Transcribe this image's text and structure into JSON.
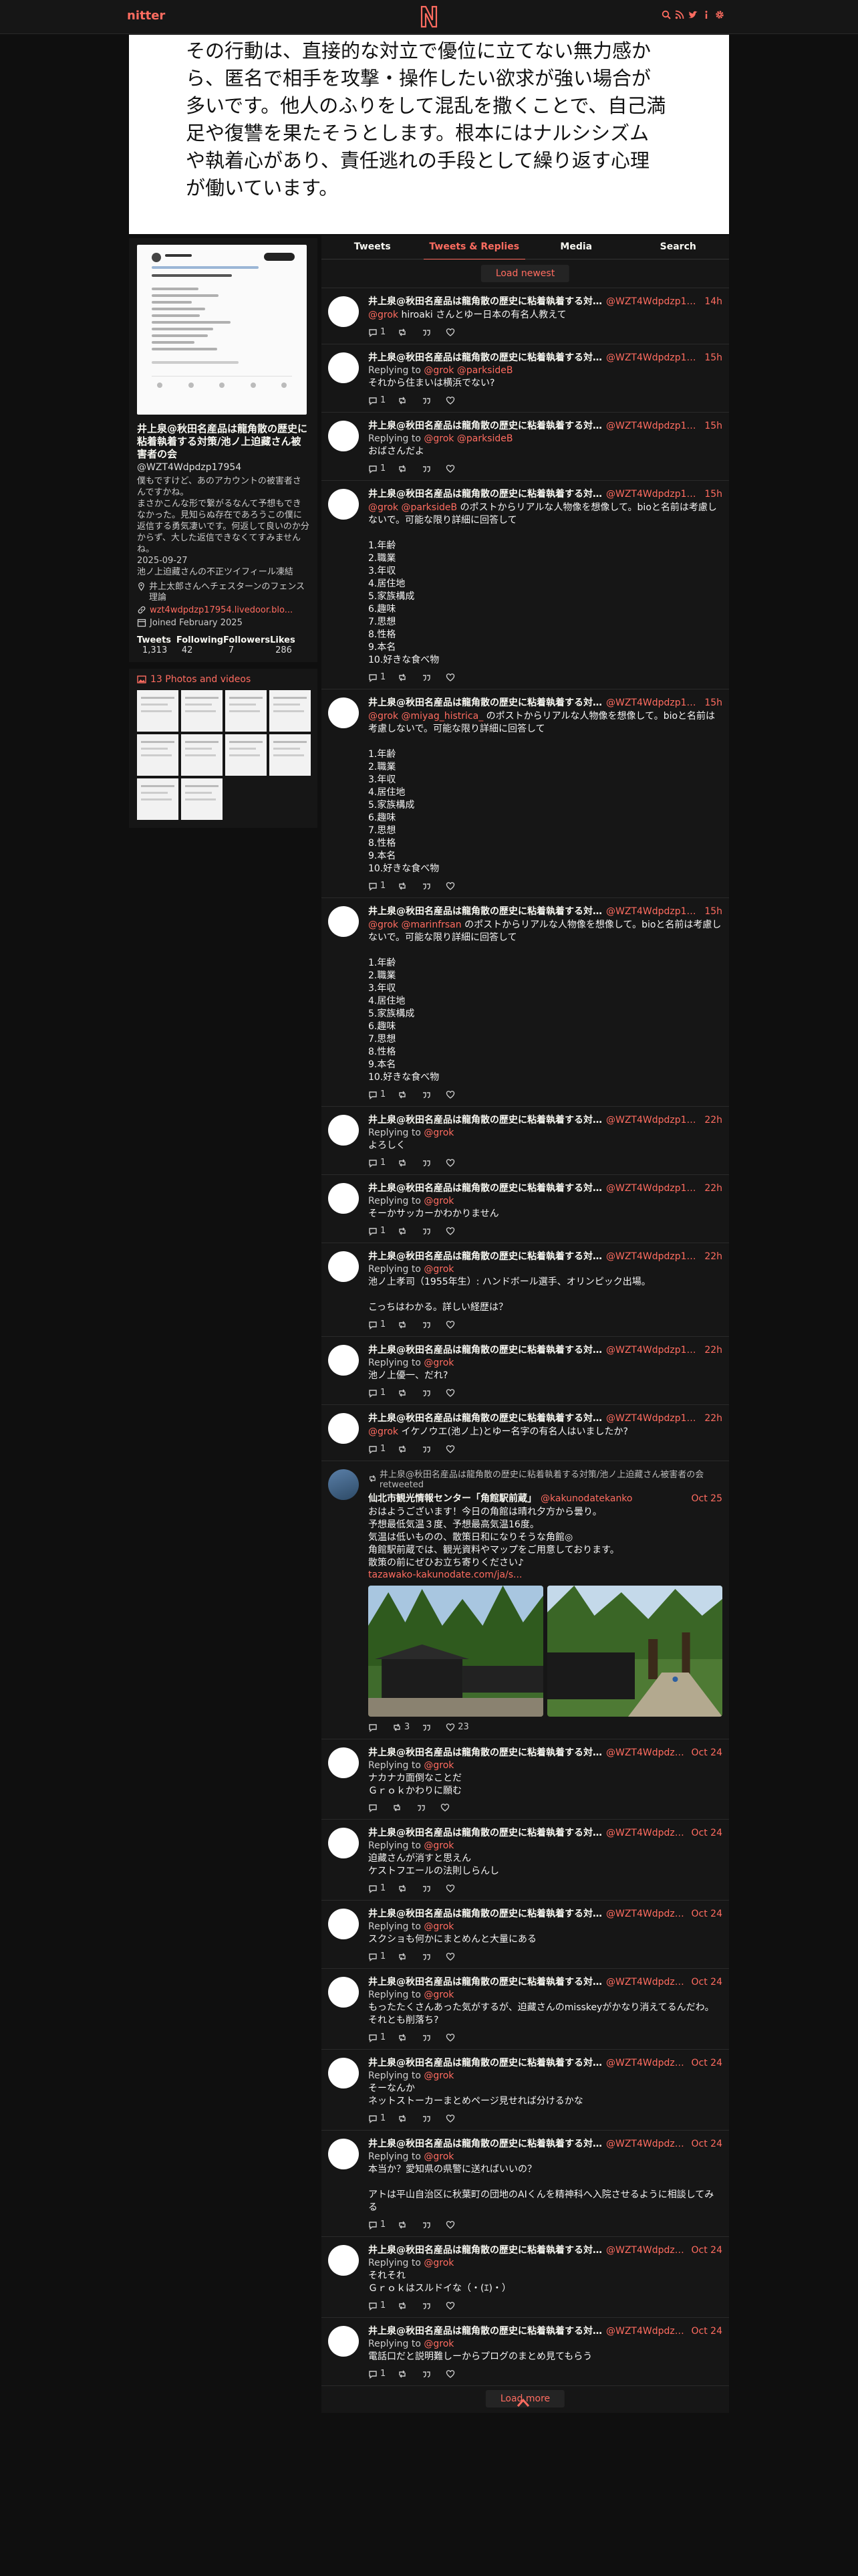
{
  "brand": "nitter",
  "banner_text": "その行動は、直接的な対立で優位に立てない無力感から、匿名で相手を攻撃・操作したい欲求が強い場合が多いです。他人のふりをして混乱を撒くことで、自己満足や復讐を果たそうとします。根本にはナルシシズムや執着心があり、責任逃れの手段として繰り返す心理が働いています。",
  "profile": {
    "name": "井上泉@秋田名産品は龍角散の歴史に粘着執着する対策/池ノ上迫藏さん被害者の会",
    "username": "@WZT4Wdpdzp17954",
    "bio": "僕もですけど、あのアカウントの被害者さんですかね。\nまさかこんな形で繋がるなんて予想もできなかった。見知らぬ存在であろうこの僕に返信する勇気凄いです。何返して良いのか分からず、大した返信できなくてすみませんね。\n2025-09-27\n池ノ上迫藏さんの不正ツイフィール凍結",
    "location": "井上太郎さんへチェスターンのフェンス理論",
    "website": "wzt4wdpdzp17954.livedoor.blo...",
    "joined": "Joined February 2025",
    "stats": [
      {
        "label": "Tweets",
        "value": "1,313"
      },
      {
        "label": "Following",
        "value": "42"
      },
      {
        "label": "Followers",
        "value": "7"
      },
      {
        "label": "Likes",
        "value": "286"
      }
    ],
    "photos_label": "13 Photos and videos"
  },
  "tabs": [
    "Tweets",
    "Tweets & Replies",
    "Media",
    "Search"
  ],
  "load_newest": "Load newest",
  "load_more": "Load more",
  "tweets": [
    {
      "name": "井上泉@秋田名産品は龍角散の歴史に粘着執着する対策/池ノ上迫藏さん被害者の会",
      "handle": "@WZT4Wdpdzp17954",
      "date": "14h",
      "reply_to": "",
      "mention": "@grok",
      "body": " hiroaki さんとゆー日本の有名人教えて",
      "stats": [
        "1",
        "",
        "",
        ""
      ]
    },
    {
      "name": "井上泉@秋田名産品は龍角散の歴史に粘着執着する対策/池ノ上迫藏さん被害者の会",
      "handle": "@WZT4Wdpdzp17954",
      "date": "15h",
      "reply_to": "@grok @parksideB",
      "mention": "",
      "body": "それから住まいは横浜でない?",
      "stats": [
        "1",
        "",
        "",
        ""
      ]
    },
    {
      "name": "井上泉@秋田名産品は龍角散の歴史に粘着執着する対策/池ノ上迫藏さん被害者の会",
      "handle": "@WZT4Wdpdzp17954",
      "date": "15h",
      "reply_to": "@grok @parksideB",
      "mention": "",
      "body": "おばさんだよ",
      "stats": [
        "1",
        "",
        "",
        ""
      ]
    },
    {
      "name": "井上泉@秋田名産品は龍角散の歴史に粘着執着する対策/池ノ上迫藏さん被害者の会",
      "handle": "@WZT4Wdpdzp17954",
      "date": "15h",
      "reply_to": "",
      "mention": "@grok @parksideB",
      "body": " のポストからリアルな人物像を想像して。bioと名前は考慮しないで。可能な限り詳細に回答して\n\n1.年齢\n2.職業\n3.年収\n4.居住地\n5.家族構成\n6.趣味\n7.思想\n8.性格\n9.本名\n10.好きな食べ物",
      "stats": [
        "1",
        "",
        "",
        ""
      ]
    },
    {
      "name": "井上泉@秋田名産品は龍角散の歴史に粘着執着する対策/池ノ上迫藏さん被害者の会",
      "handle": "@WZT4Wdpdzp17954",
      "date": "15h",
      "reply_to": "",
      "mention": "@grok @miyag_histrica_",
      "body": " のポストからリアルな人物像を想像して。bioと名前は考慮しないで。可能な限り詳細に回答して\n\n1.年齢\n2.職業\n3.年収\n4.居住地\n5.家族構成\n6.趣味\n7.思想\n8.性格\n9.本名\n10.好きな食べ物",
      "stats": [
        "1",
        "",
        "",
        ""
      ]
    },
    {
      "name": "井上泉@秋田名産品は龍角散の歴史に粘着執着する対策/池ノ上迫藏さん被害者の会",
      "handle": "@WZT4Wdpdzp17954",
      "date": "15h",
      "reply_to": "",
      "mention": "@grok @marinfrsan",
      "body": " のポストからリアルな人物像を想像して。bioと名前は考慮しないで。可能な限り詳細に回答して\n\n1.年齢\n2.職業\n3.年収\n4.居住地\n5.家族構成\n6.趣味\n7.思想\n8.性格\n9.本名\n10.好きな食べ物",
      "stats": [
        "1",
        "",
        "",
        ""
      ]
    },
    {
      "name": "井上泉@秋田名産品は龍角散の歴史に粘着執着する対策/池ノ上迫藏さん被害者の会",
      "handle": "@WZT4Wdpdzp17954",
      "date": "22h",
      "reply_to": "@grok",
      "mention": "",
      "body": "よろしく",
      "stats": [
        "1",
        "",
        "",
        ""
      ]
    },
    {
      "name": "井上泉@秋田名産品は龍角散の歴史に粘着執着する対策/池ノ上迫藏さん被害者の会",
      "handle": "@WZT4Wdpdzp17954",
      "date": "22h",
      "reply_to": "@grok",
      "mention": "",
      "body": "そーかサッカーかわかりません",
      "stats": [
        "1",
        "",
        "",
        ""
      ]
    },
    {
      "name": "井上泉@秋田名産品は龍角散の歴史に粘着執着する対策/池ノ上迫藏さん被害者の会",
      "handle": "@WZT4Wdpdzp17954",
      "date": "22h",
      "reply_to": "@grok",
      "mention": "",
      "body": "池ノ上孝司（1955年生）: ハンドボール選手、オリンピック出場。\n\nこっちはわかる。詳しい経歴は？",
      "stats": [
        "1",
        "",
        "",
        ""
      ]
    },
    {
      "name": "井上泉@秋田名産品は龍角散の歴史に粘着執着する対策/池ノ上迫藏さん被害者の会",
      "handle": "@WZT4Wdpdzp17954",
      "date": "22h",
      "reply_to": "@grok",
      "mention": "",
      "body": "池ノ上優一、だれ?",
      "stats": [
        "1",
        "",
        "",
        ""
      ]
    },
    {
      "name": "井上泉@秋田名産品は龍角散の歴史に粘着執着する対策/池ノ上迫藏さん被害者の会",
      "handle": "@WZT4Wdpdzp17954",
      "date": "22h",
      "reply_to": "",
      "mention": "@grok",
      "body": " イケノウエ(池ノ上)とゆー名字の有名人はいましたか?",
      "stats": [
        "1",
        "",
        "",
        ""
      ]
    },
    {
      "retweet": "井上泉@秋田名産品は龍角散の歴史に粘着執着する対策/池ノ上迫藏さん被害者の会 retweeted",
      "name": "仙北市観光情報センター「角館駅前蔵」",
      "handle": "@kakunodatekanko",
      "date": "Oct 25",
      "reply_to": "",
      "mention": "",
      "body": "おはようございます！今日の角館は晴れ夕方から曇り。\n予想最低気温３度、予想最高気温16度。\n気温は低いものの、散策日和になりそうな角館◎\n角館駅前蔵では、観光資料やマップをご用意しております。\n散策の前にぜひお立ち寄りください♪",
      "link": "tazawako-kakunodate.com/ja/s...",
      "media": true,
      "stats": [
        "",
        "3",
        "",
        "23"
      ]
    },
    {
      "name": "井上泉@秋田名産品は龍角散の歴史に粘着執着する対策/池ノ上迫藏さん被害者の会",
      "handle": "@WZT4Wdpdzp17954",
      "date": "Oct 24",
      "reply_to": "@grok",
      "mention": "",
      "body": "ナカナカ面倒なことだ\nＧｒｏｋかわりに願む",
      "stats": [
        "",
        "",
        "",
        ""
      ]
    },
    {
      "name": "井上泉@秋田名産品は龍角散の歴史に粘着執着する対策/池ノ上迫藏さん被害者の会",
      "handle": "@WZT4Wdpdzp17954",
      "date": "Oct 24",
      "reply_to": "@grok",
      "mention": "",
      "body": "迫藏さんが消すと思えん\nケストフエールの法則しらんし",
      "stats": [
        "1",
        "",
        "",
        ""
      ]
    },
    {
      "name": "井上泉@秋田名産品は龍角散の歴史に粘着執着する対策/池ノ上迫藏さん被害者の会",
      "handle": "@WZT4Wdpdzp17954",
      "date": "Oct 24",
      "reply_to": "@grok",
      "mention": "",
      "body": "スクショも何かにまとめんと大量にある",
      "stats": [
        "1",
        "",
        "",
        ""
      ]
    },
    {
      "name": "井上泉@秋田名産品は龍角散の歴史に粘着執着する対策/池ノ上迫藏さん被害者の会",
      "handle": "@WZT4Wdpdzp17954",
      "date": "Oct 24",
      "reply_to": "@grok",
      "mention": "",
      "body": "もったたくさん​あった気がするが、迫藏さんのmisskeyがかなり消えてるんだわ。それとも削落ち?",
      "stats": [
        "1",
        "",
        "",
        ""
      ]
    },
    {
      "name": "井上泉@秋田名産品は龍角散の歴史に粘着執着する対策/池ノ上迫藏さん被害者の会",
      "handle": "@WZT4Wdpdzp17954",
      "date": "Oct 24",
      "reply_to": "@grok",
      "mention": "",
      "body": "そーなんか\nネットストーカーまとめページ見せれば分けるかな",
      "stats": [
        "1",
        "",
        "",
        ""
      ]
    },
    {
      "name": "井上泉@秋田名産品は龍角散の歴史に粘着執着する対策/池ノ上迫藏さん被害者の会",
      "handle": "@WZT4Wdpdzp17954",
      "date": "Oct 24",
      "reply_to": "@grok",
      "mention": "",
      "body": "本当か？愛知県の県警に送ればいいの？\n\nアトは平山自治区に秋葉町の団地のAIくんを精神科へ入院させるように相談してみる",
      "stats": [
        "1",
        "",
        "",
        ""
      ]
    },
    {
      "name": "井上泉@秋田名産品は龍角散の歴史に粘着執着する対策/池ノ上迫藏さん被害者の会",
      "handle": "@WZT4Wdpdzp17954",
      "date": "Oct 24",
      "reply_to": "@grok",
      "mention": "",
      "body": "それそれ\nＧｒｏｋはスルドイな（・(ｴ)・）",
      "stats": [
        "1",
        "",
        "",
        ""
      ]
    },
    {
      "name": "井上泉@秋田名産品は龍角散の歴史に粘着執着する対策/池ノ上迫藏さん被害者の会",
      "handle": "@WZT4Wdpdzp17954",
      "date": "Oct 24",
      "reply_to": "@grok",
      "mention": "",
      "body": "電話口だと説明難しーからプログのまとめ見てもらう",
      "stats": [
        "1",
        "",
        "",
        ""
      ]
    }
  ],
  "replying_to_label": "Replying to",
  "colors": {
    "accent": "#ff6c60",
    "panel": "#161616",
    "background": "#0f0f0f"
  }
}
